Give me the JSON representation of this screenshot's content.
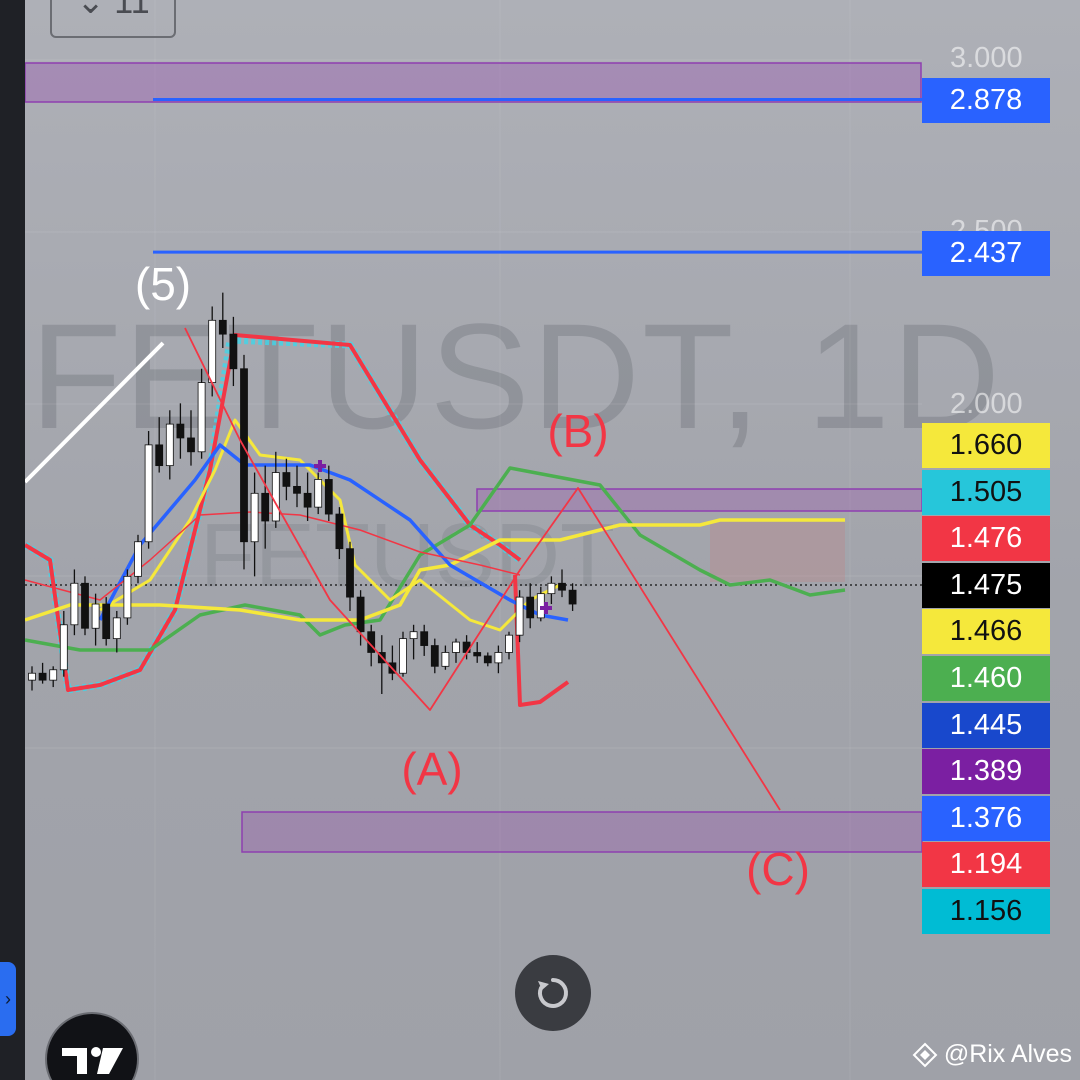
{
  "watermark": {
    "symbol_line": "FETUSDT, 1D",
    "faint_symbol": "FETUSDT"
  },
  "top_button": {
    "label": "⌄ 11"
  },
  "credit": {
    "text": "@Rix Alves",
    "icon": "binance-diamond-icon"
  },
  "reset_button": {
    "icon": "reset-arrow-icon"
  },
  "logo": {
    "icon": "tradingview-logo-icon",
    "text": "TV"
  },
  "chart_data": {
    "type": "candlestick",
    "symbol": "FETUSDT",
    "timeframe": "1D",
    "price_axis": {
      "ticks": [
        "3.000",
        "2.500",
        "2.000"
      ],
      "tick_values": [
        3.0,
        2.5,
        2.0
      ]
    },
    "last_price": 1.475,
    "price_labels": [
      {
        "text": "2.878",
        "value": 2.878,
        "bg": "#2962ff",
        "fg": "#ffffff"
      },
      {
        "text": "2.437",
        "value": 2.437,
        "bg": "#2962ff",
        "fg": "#ffffff"
      },
      {
        "text": "1.660",
        "value": 1.66,
        "bg": "#f5e83b",
        "fg": "#111111"
      },
      {
        "text": "1.505",
        "value": 1.505,
        "bg": "#26c6da",
        "fg": "#111111"
      },
      {
        "text": "1.476",
        "value": 1.476,
        "bg": "#f23645",
        "fg": "#ffffff"
      },
      {
        "text": "1.475",
        "value": 1.475,
        "bg": "#000000",
        "fg": "#ffffff"
      },
      {
        "text": "1.466",
        "value": 1.466,
        "bg": "#f5e83b",
        "fg": "#111111"
      },
      {
        "text": "1.460",
        "value": 1.46,
        "bg": "#4caf50",
        "fg": "#ffffff"
      },
      {
        "text": "1.445",
        "value": 1.445,
        "bg": "#1848cc",
        "fg": "#ffffff"
      },
      {
        "text": "1.389",
        "value": 1.389,
        "bg": "#7b1fa2",
        "fg": "#ffffff"
      },
      {
        "text": "1.376",
        "value": 1.376,
        "bg": "#2962ff",
        "fg": "#ffffff"
      },
      {
        "text": "1.194",
        "value": 1.194,
        "bg": "#f23645",
        "fg": "#ffffff"
      },
      {
        "text": "1.156",
        "value": 1.156,
        "bg": "#00bcd4",
        "fg": "#111111"
      }
    ],
    "horizontal_lines": [
      {
        "value": 2.878,
        "color": "#2962ff"
      },
      {
        "value": 2.437,
        "color": "#2962ff"
      }
    ],
    "wave_labels": [
      {
        "text": "(5)",
        "color": "#ffffff"
      },
      {
        "text": "(B)",
        "color": "#f23645"
      },
      {
        "text": "(A)",
        "color": "#f23645"
      },
      {
        "text": "(C)",
        "color": "#f23645"
      }
    ],
    "candles": [
      [
        1.2,
        1.24,
        1.17,
        1.22
      ],
      [
        1.22,
        1.25,
        1.19,
        1.2
      ],
      [
        1.2,
        1.24,
        1.18,
        1.23
      ],
      [
        1.23,
        1.4,
        1.21,
        1.36
      ],
      [
        1.36,
        1.52,
        1.33,
        1.48
      ],
      [
        1.48,
        1.5,
        1.33,
        1.35
      ],
      [
        1.35,
        1.45,
        1.3,
        1.42
      ],
      [
        1.42,
        1.44,
        1.3,
        1.32
      ],
      [
        1.32,
        1.4,
        1.28,
        1.38
      ],
      [
        1.38,
        1.52,
        1.36,
        1.5
      ],
      [
        1.5,
        1.62,
        1.48,
        1.6
      ],
      [
        1.6,
        1.92,
        1.58,
        1.88
      ],
      [
        1.88,
        1.96,
        1.8,
        1.82
      ],
      [
        1.82,
        1.98,
        1.78,
        1.94
      ],
      [
        1.94,
        2.0,
        1.84,
        1.9
      ],
      [
        1.9,
        1.98,
        1.82,
        1.86
      ],
      [
        1.86,
        2.1,
        1.84,
        2.06
      ],
      [
        2.06,
        2.28,
        2.02,
        2.24
      ],
      [
        2.24,
        2.32,
        2.16,
        2.2
      ],
      [
        2.2,
        2.25,
        2.05,
        2.1
      ],
      [
        2.1,
        2.14,
        1.52,
        1.6
      ],
      [
        1.6,
        1.8,
        1.5,
        1.74
      ],
      [
        1.74,
        1.82,
        1.58,
        1.66
      ],
      [
        1.66,
        1.86,
        1.64,
        1.8
      ],
      [
        1.8,
        1.84,
        1.72,
        1.76
      ],
      [
        1.76,
        1.82,
        1.7,
        1.74
      ],
      [
        1.74,
        1.8,
        1.66,
        1.7
      ],
      [
        1.7,
        1.8,
        1.68,
        1.78
      ],
      [
        1.78,
        1.82,
        1.66,
        1.68
      ],
      [
        1.68,
        1.7,
        1.55,
        1.58
      ],
      [
        1.58,
        1.6,
        1.4,
        1.44
      ],
      [
        1.44,
        1.46,
        1.3,
        1.34
      ],
      [
        1.34,
        1.36,
        1.24,
        1.28
      ],
      [
        1.28,
        1.33,
        1.16,
        1.25
      ],
      [
        1.25,
        1.3,
        1.2,
        1.22
      ],
      [
        1.22,
        1.34,
        1.21,
        1.32
      ],
      [
        1.32,
        1.36,
        1.26,
        1.34
      ],
      [
        1.34,
        1.36,
        1.27,
        1.3
      ],
      [
        1.3,
        1.32,
        1.22,
        1.24
      ],
      [
        1.24,
        1.3,
        1.23,
        1.28
      ],
      [
        1.28,
        1.32,
        1.25,
        1.31
      ],
      [
        1.31,
        1.33,
        1.26,
        1.28
      ],
      [
        1.28,
        1.31,
        1.25,
        1.27
      ],
      [
        1.27,
        1.28,
        1.24,
        1.25
      ],
      [
        1.25,
        1.3,
        1.22,
        1.28
      ],
      [
        1.28,
        1.34,
        1.26,
        1.33
      ],
      [
        1.33,
        1.46,
        1.31,
        1.44
      ],
      [
        1.44,
        1.48,
        1.35,
        1.38
      ],
      [
        1.38,
        1.47,
        1.37,
        1.45
      ],
      [
        1.45,
        1.5,
        1.42,
        1.48
      ],
      [
        1.48,
        1.52,
        1.44,
        1.46
      ],
      [
        1.46,
        1.48,
        1.4,
        1.42
      ]
    ]
  }
}
